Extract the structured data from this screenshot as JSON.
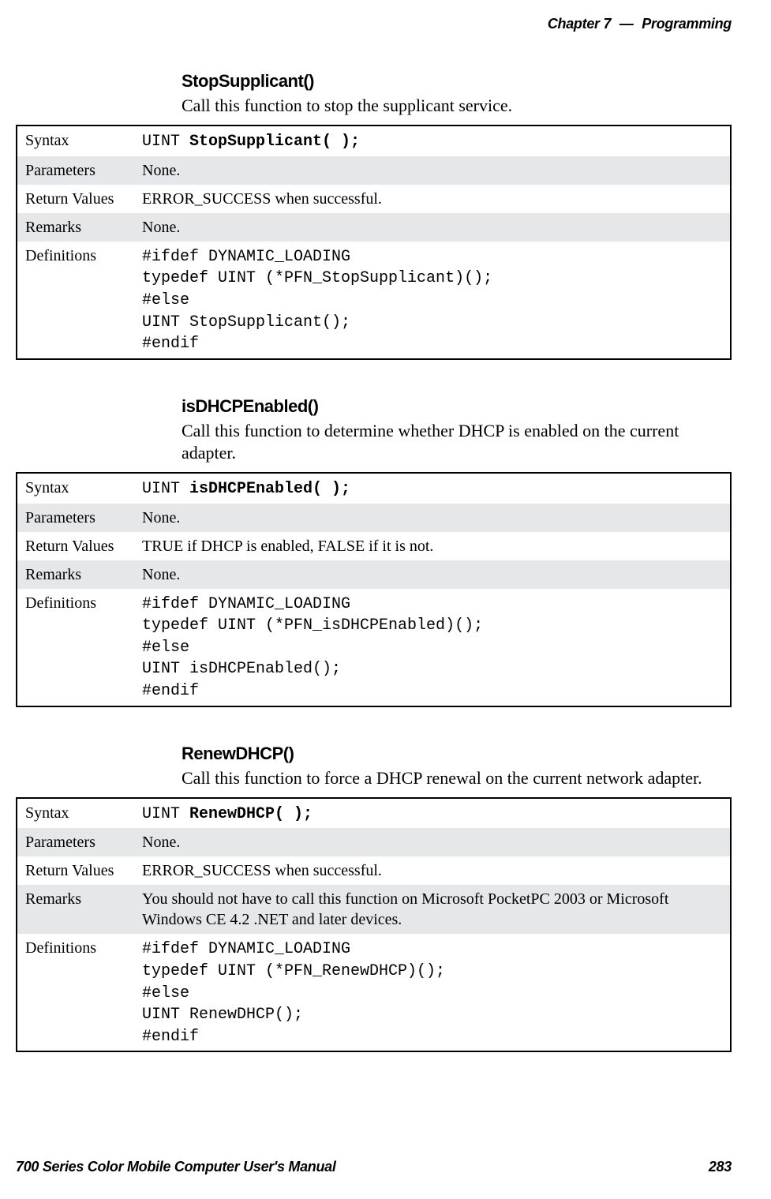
{
  "header": {
    "chapter_label": "Chapter",
    "chapter_num": "7",
    "chapter_title": "Programming"
  },
  "footer": {
    "manual_title": "700 Series Color Mobile Computer User's Manual",
    "page_number": "283"
  },
  "functions": [
    {
      "name": "StopSupplicant()",
      "desc": "Call this function to stop the supplicant service.",
      "rows": {
        "syntax_prefix": "UINT ",
        "syntax_bold": "StopSupplicant( );",
        "parameters": "None.",
        "return_values": "ERROR_SUCCESS when successful.",
        "remarks": "None.",
        "definitions": "#ifdef DYNAMIC_LOADING\ntypedef UINT (*PFN_StopSupplicant)();\n#else\nUINT StopSupplicant();\n#endif"
      }
    },
    {
      "name": "isDHCPEnabled()",
      "desc": "Call this function to determine whether DHCP is enabled on the current adapter.",
      "rows": {
        "syntax_prefix": "UINT ",
        "syntax_bold": "isDHCPEnabled( );",
        "parameters": "None.",
        "return_values": "TRUE if DHCP is enabled, FALSE if it is not.",
        "remarks": "None.",
        "definitions": "#ifdef DYNAMIC_LOADING\ntypedef UINT (*PFN_isDHCPEnabled)();\n#else\nUINT isDHCPEnabled();\n#endif"
      }
    },
    {
      "name": "RenewDHCP()",
      "desc": "Call this function to force a DHCP renewal on the current network adapter.",
      "rows": {
        "syntax_prefix": "UINT ",
        "syntax_bold": "RenewDHCP( );",
        "parameters": "None.",
        "return_values": "ERROR_SUCCESS when successful.",
        "remarks": "You should not have to call this function on Microsoft PocketPC 2003 or Microsoft Windows CE 4.2 .NET and later devices.",
        "definitions": "#ifdef DYNAMIC_LOADING\ntypedef UINT (*PFN_RenewDHCP)();\n#else\nUINT RenewDHCP();\n#endif"
      }
    }
  ],
  "labels": {
    "syntax": "Syntax",
    "parameters": "Parameters",
    "return_values": "Return Values",
    "remarks": "Remarks",
    "definitions": "Definitions"
  }
}
